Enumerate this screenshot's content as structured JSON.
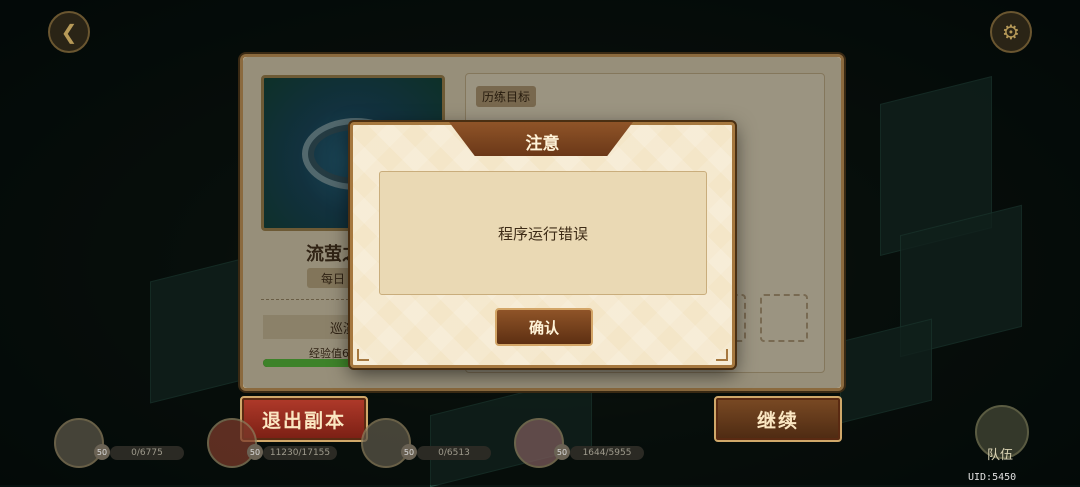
{
  "top_bar": {
    "back_icon": "back-arrow-icon",
    "settings_icon": "gear-icon"
  },
  "stage_panel": {
    "stage_name": "流萤之",
    "tag": "每日",
    "patrol_label": "巡演等",
    "exp_label": "经验值64",
    "exp_progress": 0.85,
    "goal_label": "历练目标"
  },
  "dialog": {
    "title": "注意",
    "message": "程序运行错误",
    "confirm_label": "确认"
  },
  "bottom": {
    "exit_label": "退出副本",
    "continue_label": "继续",
    "team_label": "队伍",
    "uid": "UID:5450",
    "members": [
      {
        "hp": "0/6775",
        "level": "50"
      },
      {
        "hp": "11230/17155",
        "level": "50"
      },
      {
        "hp": "0/6513",
        "level": "50"
      },
      {
        "hp": "1644/5955",
        "level": "50"
      }
    ]
  },
  "colors": {
    "accent": "#8f5428",
    "exit_button": "#b03a2a",
    "exp_fill": "#5fc840"
  }
}
